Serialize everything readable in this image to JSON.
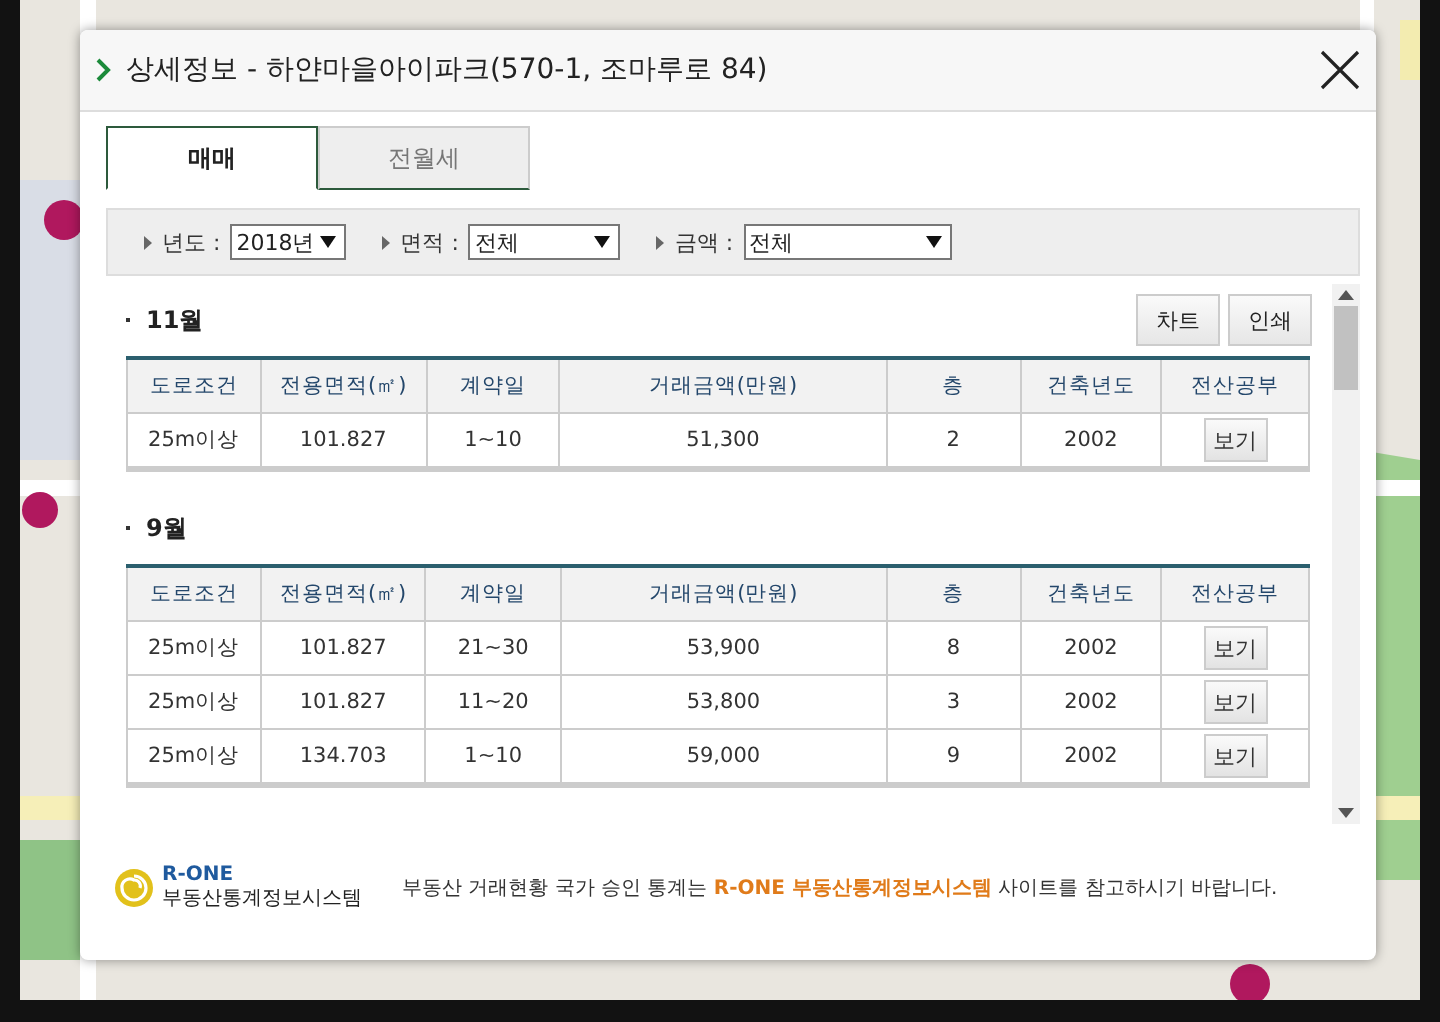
{
  "dialog": {
    "title": "상세정보 - 하얀마을아이파크(570-1, 조마루로 84)",
    "tabs": [
      {
        "label": "매매",
        "selected": true
      },
      {
        "label": "전월세",
        "selected": false
      }
    ],
    "filters": [
      {
        "label": "년도 :",
        "value": "2018년"
      },
      {
        "label": "면적 :",
        "value": "전체"
      },
      {
        "label": "금액 :",
        "value": "전체"
      }
    ],
    "sections": [
      {
        "heading": "11월",
        "buttons": [
          "차트",
          "인쇄"
        ],
        "columns": [
          "도로조건",
          "전용면적(㎡)",
          "계약일",
          "거래금액(만원)",
          "층",
          "건축년도",
          "전산공부"
        ],
        "rows": [
          {
            "cells": [
              "25m이상",
              "101.827",
              "1~10",
              "51,300",
              "2",
              "2002"
            ],
            "action": "보기"
          }
        ]
      },
      {
        "heading": "9월",
        "columns": [
          "도로조건",
          "전용면적(㎡)",
          "계약일",
          "거래금액(만원)",
          "층",
          "건축년도",
          "전산공부"
        ],
        "rows": [
          {
            "cells": [
              "25m이상",
              "101.827",
              "21~30",
              "53,900",
              "8",
              "2002"
            ],
            "action": "보기"
          },
          {
            "cells": [
              "25m이상",
              "101.827",
              "11~20",
              "53,800",
              "3",
              "2002"
            ],
            "action": "보기"
          },
          {
            "cells": [
              "25m이상",
              "134.703",
              "1~10",
              "59,000",
              "9",
              "2002"
            ],
            "action": "보기"
          }
        ]
      }
    ],
    "footer": {
      "logo_top": "R-ONE",
      "logo_bottom": "부동산통계정보시스템",
      "notice": "부동산 거래현황 국가 승인 통계는 **R-ONE 부동산통계정보시스템** 사이트를 참고하시기 바랍니다."
    }
  }
}
